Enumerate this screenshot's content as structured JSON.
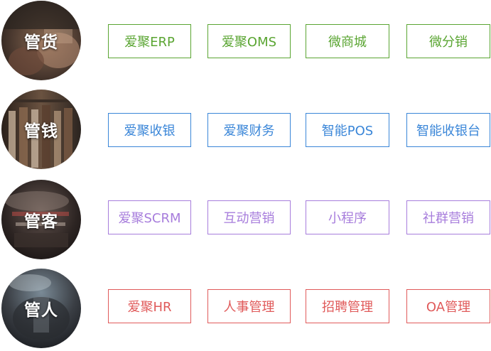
{
  "categories": [
    {
      "label": "管货",
      "color": "#5aa532",
      "items": [
        "爱聚ERP",
        "爱聚OMS",
        "微商城",
        "微分销"
      ]
    },
    {
      "label": "管钱",
      "color": "#3a86d8",
      "items": [
        "爱聚收银",
        "爱聚财务",
        "智能POS",
        "智能收银台"
      ]
    },
    {
      "label": "管客",
      "color": "#a77ddc",
      "items": [
        "爱聚SCRM",
        "互动营销",
        "小程序",
        "社群营销"
      ]
    },
    {
      "label": "管人",
      "color": "#e05a5a",
      "items": [
        "爱聚HR",
        "人事管理",
        "招聘管理",
        "OA管理"
      ]
    }
  ]
}
